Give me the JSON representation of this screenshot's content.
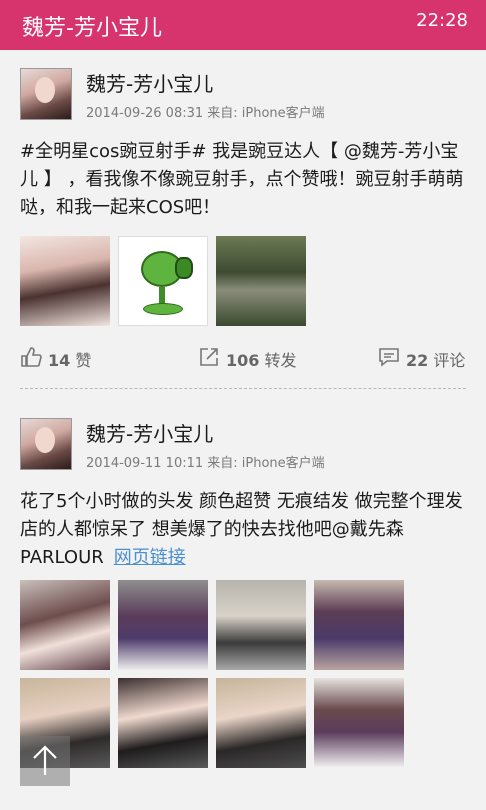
{
  "header": {
    "title": "魏芳-芳小宝儿",
    "clock": "22:28"
  },
  "posts": [
    {
      "author": "魏芳-芳小宝儿",
      "meta": "2014-09-26 08:31 来自: iPhone客户端",
      "content": "#全明星cos豌豆射手#  我是豌豆达人【 @魏芳-芳小宝儿 】 ，看我像不像豌豆射手，点个赞哦！豌豆射手萌萌哒，和我一起来COS吧！",
      "likes": "14",
      "likes_label": "赞",
      "reposts": "106",
      "reposts_label": "转发",
      "comments": "22",
      "comments_label": "评论"
    },
    {
      "author": "魏芳-芳小宝儿",
      "meta": "2014-09-11 10:11 来自: iPhone客户端",
      "content": "花了5个小时做的头发 颜色超赞 无痕结发 做完整个理发店的人都惊呆了 想美爆了的快去找他吧@戴先森PARLOUR",
      "link": "网页链接"
    }
  ],
  "icons": {
    "like": "thumbs-up-icon",
    "repost": "share-icon",
    "comment": "comment-icon",
    "scroll_top": "arrow-up-icon"
  },
  "colors": {
    "accent": "#d7336d",
    "link": "#4a8fd1"
  }
}
